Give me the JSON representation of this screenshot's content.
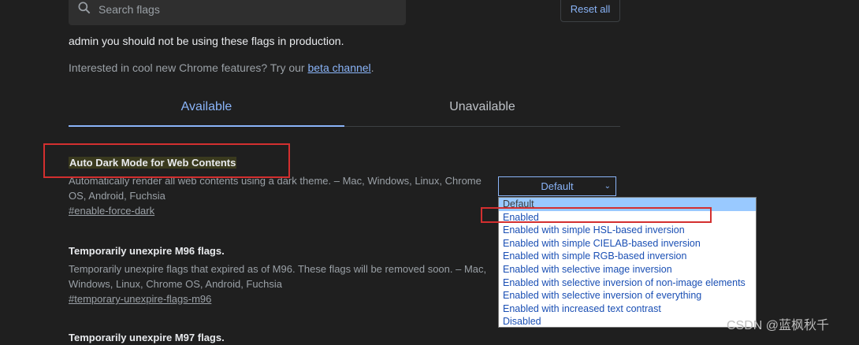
{
  "search": {
    "placeholder": "Search flags"
  },
  "reset_label": "Reset all",
  "warning_line": "admin you should not be using these flags in production.",
  "interest": {
    "prefix": "Interested in cool new Chrome features? Try our ",
    "link": "beta channel",
    "suffix": "."
  },
  "tabs": [
    {
      "label": "Available"
    },
    {
      "label": "Unavailable"
    }
  ],
  "experiments": [
    {
      "title": "Auto Dark Mode for Web Contents",
      "desc": "Automatically render all web contents using a dark theme. – Mac, Windows, Linux, Chrome OS, Android, Fuchsia",
      "link": "#enable-force-dark",
      "selected": "Default"
    },
    {
      "title": "Temporarily unexpire M96 flags.",
      "desc": "Temporarily unexpire flags that expired as of M96. These flags will be removed soon. – Mac, Windows, Linux, Chrome OS, Android, Fuchsia",
      "link": "#temporary-unexpire-flags-m96"
    },
    {
      "title": "Temporarily unexpire M97 flags."
    }
  ],
  "dropdown_options": [
    "Default",
    "Enabled",
    "Enabled with simple HSL-based inversion",
    "Enabled with simple CIELAB-based inversion",
    "Enabled with simple RGB-based inversion",
    "Enabled with selective image inversion",
    "Enabled with selective inversion of non-image elements",
    "Enabled with selective inversion of everything",
    "Enabled with increased text contrast",
    "Disabled"
  ],
  "watermark": "CSDN @蓝枫秋千",
  "colors": {
    "background": "#1f1f1f",
    "accent": "#8ab4f8",
    "annotation_red": "#d32f2f"
  }
}
